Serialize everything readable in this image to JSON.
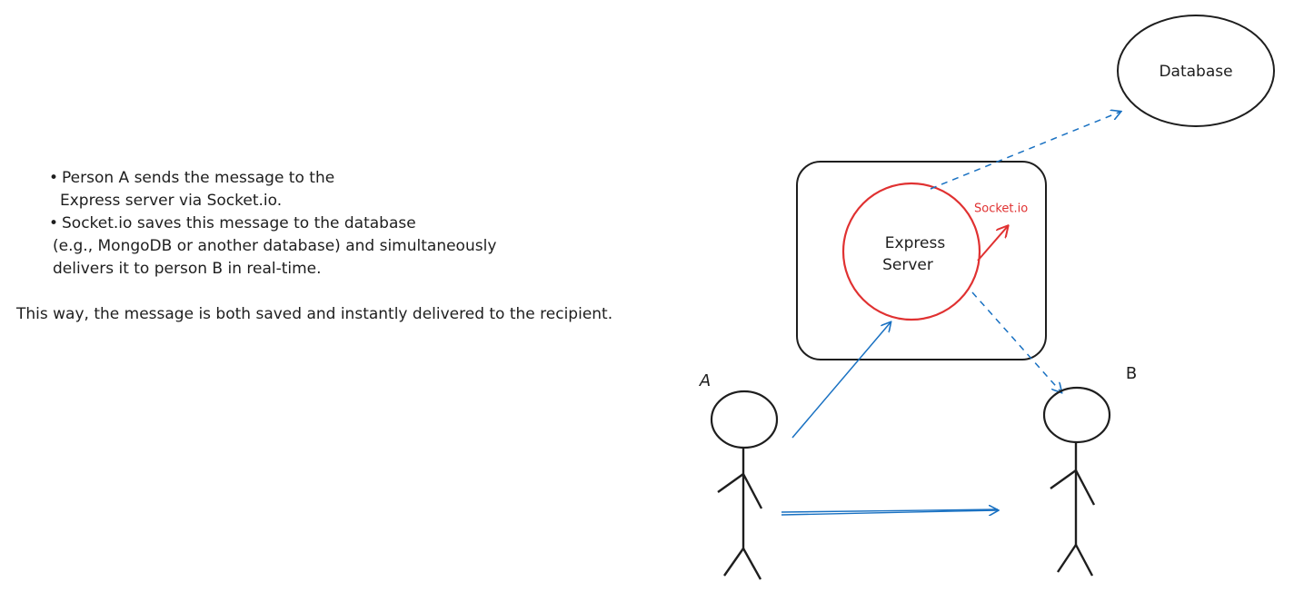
{
  "notes": {
    "bullets": [
      {
        "line1": "Person A sends the message to the",
        "line2": "Express server via Socket.io."
      },
      {
        "line1": "Socket.io saves this message to the database",
        "line2": "(e.g., MongoDB or another database) and simultaneously",
        "line3": "delivers it to person B in real-time."
      }
    ],
    "bullet_symbol": "•",
    "summary": "This way, the message is both saved and instantly delivered to the recipient."
  },
  "diagram": {
    "database_label": "Database",
    "server_label_line1": "Express",
    "server_label_line2": "Server",
    "socket_label": "Socket.io",
    "person_a_label": "A",
    "person_b_label": "B",
    "colors": {
      "ink": "#1e1e1e",
      "server_red": "#e03131",
      "arrow_blue": "#1971c2"
    }
  }
}
